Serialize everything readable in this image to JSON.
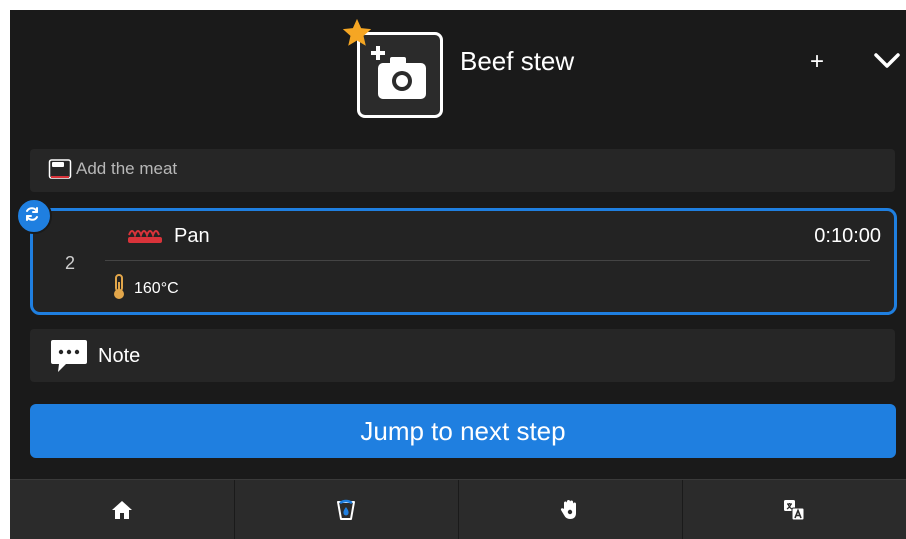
{
  "header": {
    "title": "Beef stew",
    "add_label": "+",
    "photo_icon": "add-photo-icon",
    "favorite_icon": "star-icon",
    "expand_icon": "chevron-down-icon"
  },
  "previous_step": {
    "label": "Add the meat",
    "icon": "tray-icon"
  },
  "current_step": {
    "number": "2",
    "mode": "Pan",
    "mode_icon": "pan-icon",
    "time": "0:10:00",
    "temperature": "160°C",
    "temperature_icon": "thermometer-icon",
    "sync_icon": "sync-icon"
  },
  "note": {
    "label": "Note",
    "icon": "speech-bubble-icon"
  },
  "jump_button": {
    "label": "Jump to next step"
  },
  "bottom_nav": [
    {
      "icon": "home-icon"
    },
    {
      "icon": "cleaning-icon"
    },
    {
      "icon": "hand-icon"
    },
    {
      "icon": "translate-icon"
    }
  ],
  "colors": {
    "accent": "#1f7fe0",
    "star": "#f5a623",
    "pan": "#d9333a",
    "thermometer": "#e2a64a",
    "background": "#1a1a1a"
  }
}
